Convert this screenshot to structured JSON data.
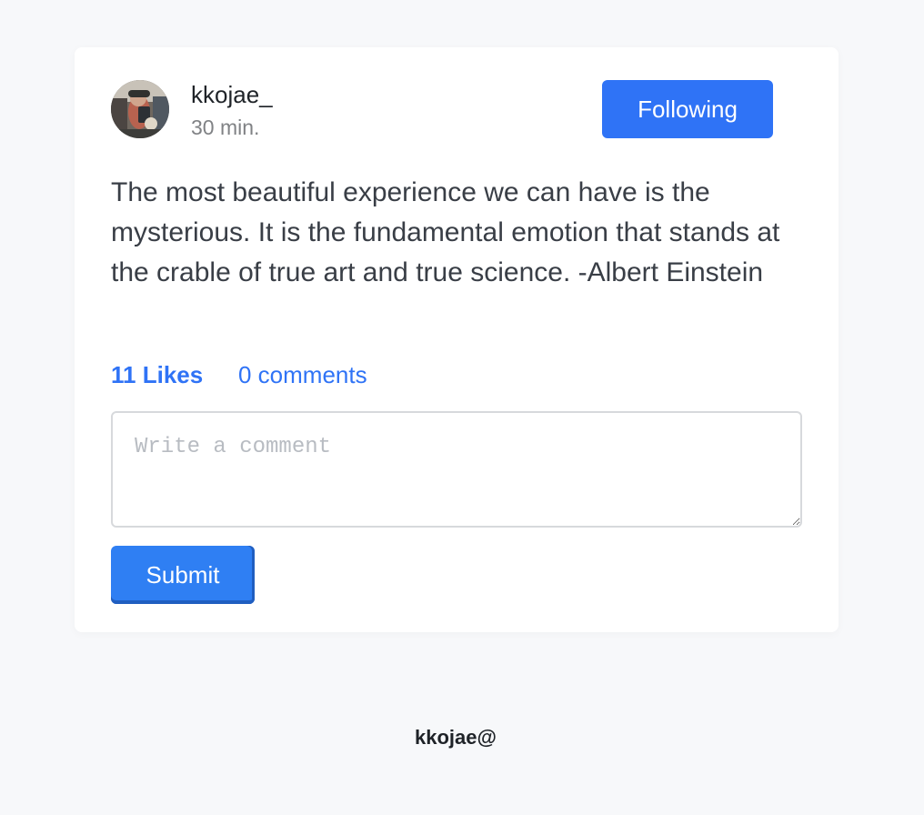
{
  "post": {
    "author": "kkojae_",
    "time": "30 min.",
    "follow_label": "Following",
    "text": "The most beautiful experience we can have is the mysterious. It is the fundamental emotion that stands at the crable of true art and true science. -Albert Einstein",
    "likes": "11 Likes",
    "comments": "0 comments"
  },
  "comment_form": {
    "placeholder": "Write a comment",
    "value": "",
    "submit_label": "Submit"
  },
  "footer": {
    "text": "kkojae@"
  },
  "colors": {
    "accent": "#2f73f6",
    "background": "#f7f8fa",
    "card": "#ffffff"
  }
}
